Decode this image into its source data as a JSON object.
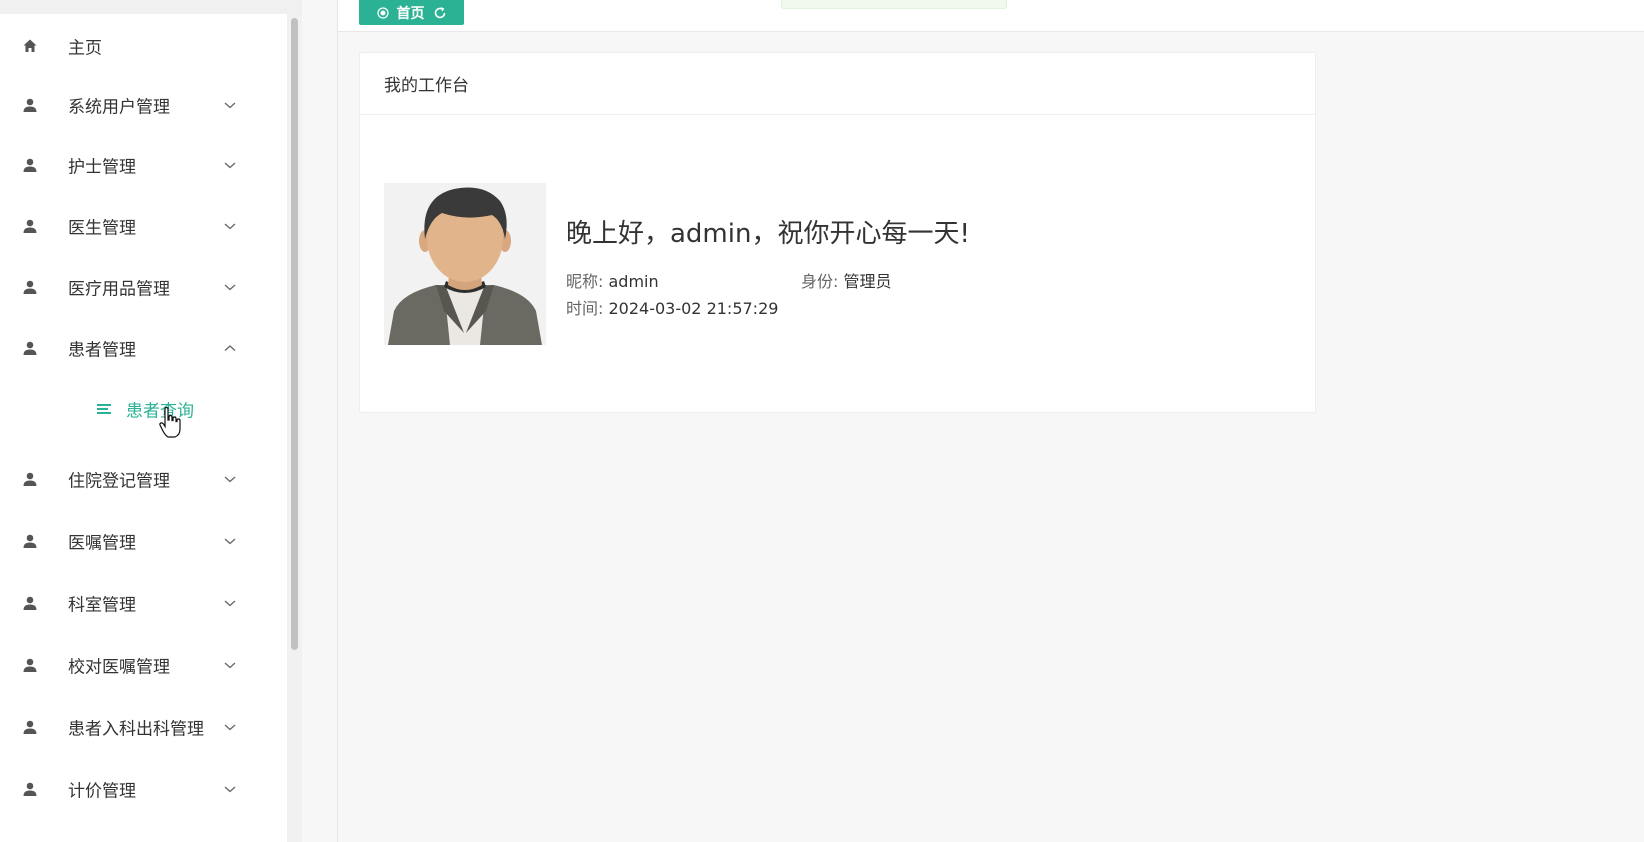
{
  "sidebar": {
    "items": [
      {
        "label": "主页",
        "icon": "home-icon",
        "expandable": false
      },
      {
        "label": "系统用户管理",
        "icon": "user-icon",
        "expandable": true,
        "expanded": false
      },
      {
        "label": "护士管理",
        "icon": "user-icon",
        "expandable": true,
        "expanded": false
      },
      {
        "label": "医生管理",
        "icon": "user-icon",
        "expandable": true,
        "expanded": false
      },
      {
        "label": "医疗用品管理",
        "icon": "user-icon",
        "expandable": true,
        "expanded": false
      },
      {
        "label": "患者管理",
        "icon": "user-icon",
        "expandable": true,
        "expanded": true
      },
      {
        "label": "住院登记管理",
        "icon": "user-icon",
        "expandable": true,
        "expanded": false
      },
      {
        "label": "医嘱管理",
        "icon": "user-icon",
        "expandable": true,
        "expanded": false
      },
      {
        "label": "科室管理",
        "icon": "user-icon",
        "expandable": true,
        "expanded": false
      },
      {
        "label": "校对医嘱管理",
        "icon": "user-icon",
        "expandable": true,
        "expanded": false
      },
      {
        "label": "患者入科出科管理",
        "icon": "user-icon",
        "expandable": true,
        "expanded": false
      },
      {
        "label": "计价管理",
        "icon": "user-icon",
        "expandable": true,
        "expanded": false
      }
    ],
    "subitem": {
      "label": "患者查询",
      "icon": "list-icon"
    }
  },
  "tabs": {
    "home_label": "首页"
  },
  "card": {
    "title": "我的工作台",
    "greeting": "晚上好，admin，祝你开心每一天!",
    "nickname_label": "昵称:",
    "nickname_value": "admin",
    "role_label": "身份:",
    "role_value": "管理员",
    "time_label": "时间:",
    "time_value": "2024-03-02 21:57:29"
  },
  "colors": {
    "accent": "#2bb294",
    "background": "#f7f7f7",
    "toast": "#f0f9eb"
  }
}
